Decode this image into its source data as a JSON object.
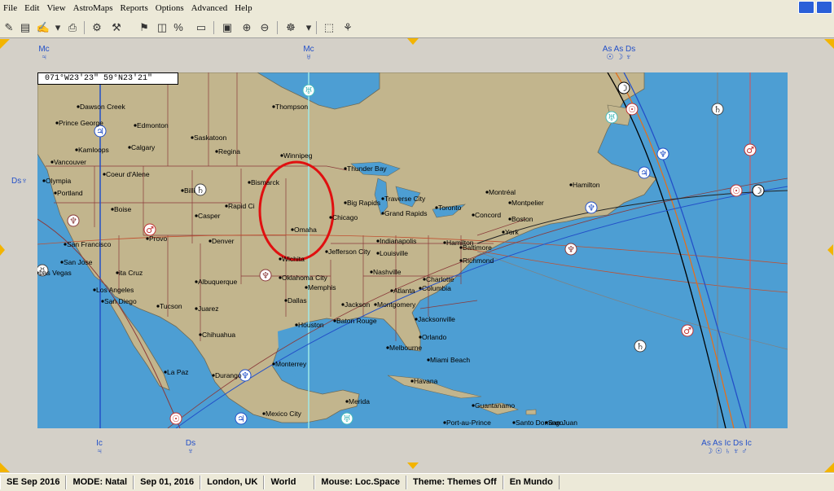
{
  "menu": [
    "File",
    "Edit",
    "View",
    "AstroMaps",
    "Reports",
    "Options",
    "Advanced",
    "Help"
  ],
  "coord_readout": "071°W23'23\"   59°N23'21\"",
  "cities": [
    "Dawson Creek",
    "Prince George",
    "Edmonton",
    "Kamloops",
    "Calgary",
    "Saskatoon",
    "Regina",
    "Thompson",
    "Vancouver",
    "Olympia",
    "Portland",
    "Coeur d'Alene",
    "Billi",
    "Boise",
    "Casper",
    "Rapid Ci",
    "Bismarck",
    "Winnipeg",
    "Thunder Bay",
    "Big Rapids",
    "Traverse City",
    "Grand Rapids",
    "Toronto",
    "Montréal",
    "Montpelier",
    "Hamilton",
    "Concord",
    "Boston",
    "York",
    "Chicago",
    "Omaha",
    "Provo",
    "Denver",
    "San Francisco",
    "San Jose",
    "ita Cruz",
    "Las Vegas",
    "Los Angeles",
    "San Diego",
    "Albuquerque",
    "Tucson",
    "Juarez",
    "Wichita",
    "Oklahoma City",
    "Memphis",
    "Dallas",
    "Jefferson City",
    "Indianapolis",
    "Louisville",
    "Nashville",
    "Hamilton",
    "Baltimore",
    "Richmond",
    "Charlotte",
    "Atlanta",
    "Columbia",
    "Jackson",
    "Montgomery",
    "Houston",
    "Baton Rouge",
    "Jacksonville",
    "Orlando",
    "Melbourne",
    "Miami Beach",
    "Havana",
    "Chihuahua",
    "La Paz",
    "Durango",
    "Monterrey",
    "Mexico City",
    "Merida",
    "Guantanamo",
    "Port-au-Prince",
    "Santo Domingo",
    "San Juan"
  ],
  "angle_labels": {
    "top": [
      {
        "text": "Mc",
        "sym": "♃"
      },
      {
        "text": "Mc",
        "sym": "♅"
      },
      {
        "text": "As As Ds",
        "sym": "☉ ☽ ♆"
      }
    ],
    "left": {
      "text": "Ds",
      "sym": "♆"
    },
    "bottom": [
      {
        "text": "Ic",
        "sym": "♃"
      },
      {
        "text": "Ds",
        "sym": "♆"
      },
      {
        "text": "As As Ic Ds Ic",
        "sym": "☽ ☉ ♄ ♆ ♂"
      }
    ]
  },
  "status": [
    "SE Sep 2016",
    "MODE: Natal",
    "Sep 01, 2016",
    "London, UK",
    "World",
    "Mouse: Loc.Space",
    "Theme: Themes Off",
    "En Mundo"
  ],
  "colors": {
    "ocean": "#4d9ed3",
    "land": "#c2b58d",
    "border": "#8a3a3a",
    "highlight": "#e01010",
    "jupiter_line": "#2350c8",
    "uranus_line": "#9fe8e8",
    "accent": "#f3b400"
  }
}
